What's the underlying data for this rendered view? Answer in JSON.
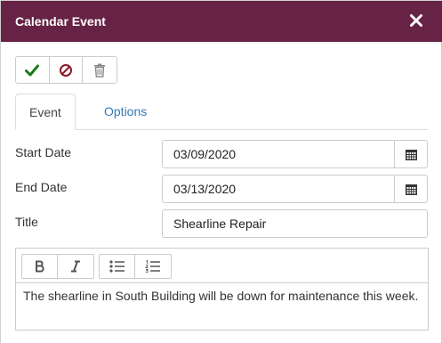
{
  "dialog": {
    "title": "Calendar Event",
    "close_icon": "close-icon",
    "header_color": "#662345"
  },
  "toolbar": {
    "save_icon": "checkmark-icon",
    "cancel_icon": "cancel-icon",
    "delete_icon": "trash-icon",
    "save_color": "#1a7a1a",
    "cancel_color": "#8b1a2b"
  },
  "tabs": [
    {
      "label": "Event",
      "active": true
    },
    {
      "label": "Options",
      "active": false
    }
  ],
  "form": {
    "start_date_label": "Start Date",
    "start_date_value": "03/09/2020",
    "end_date_label": "End Date",
    "end_date_value": "03/13/2020",
    "title_label": "Title",
    "title_value": "Shearline Repair"
  },
  "editor": {
    "bold_icon": "bold-icon",
    "italic_icon": "italic-icon",
    "bullet_list_icon": "bullet-list-icon",
    "numbered_list_icon": "numbered-list-icon",
    "content": "The shearline in South Building will be down for maintenance this week."
  }
}
